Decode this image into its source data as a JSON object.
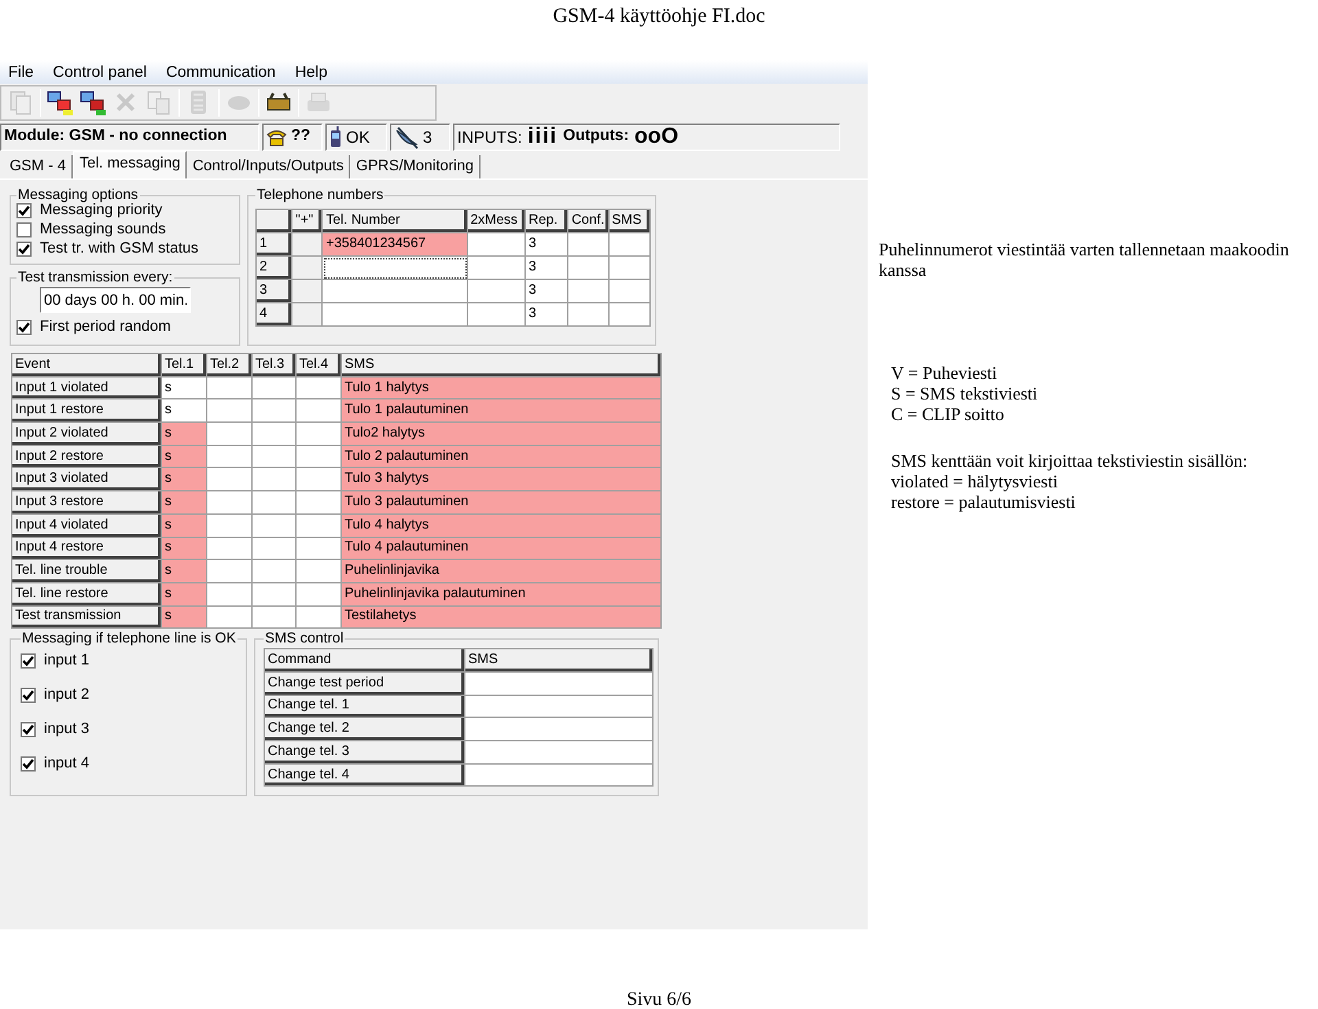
{
  "document": {
    "title": "GSM-4 käyttöohje FI.doc",
    "footer": "Sivu 6/6"
  },
  "app": {
    "menu": [
      "File",
      "Control panel",
      "Communication",
      "Help"
    ],
    "toolbar": [
      {
        "kind": "pages",
        "disabled": true
      },
      {
        "kind": "separator"
      },
      {
        "kind": "network",
        "disabled": false
      },
      {
        "kind": "network_alt",
        "disabled": false
      },
      {
        "kind": "delete",
        "disabled": true
      },
      {
        "kind": "copy",
        "disabled": true
      },
      {
        "kind": "separator"
      },
      {
        "kind": "keypad",
        "disabled": true
      },
      {
        "kind": "separator"
      },
      {
        "kind": "oval",
        "disabled": true
      },
      {
        "kind": "separator"
      },
      {
        "kind": "modem",
        "disabled": false
      },
      {
        "kind": "separator"
      },
      {
        "kind": "printer",
        "disabled": true
      }
    ],
    "status": {
      "module": "Module: GSM - no connection",
      "phone": "??",
      "gsm": "OK",
      "satellite": "3",
      "inputs_label": "INPUTS:",
      "inputs_value": "iiii",
      "outputs_label": "Outputs:",
      "outputs_value": "ooO"
    },
    "tabs": [
      {
        "label": "GSM - 4",
        "selected": false
      },
      {
        "label": "Tel. messaging",
        "selected": true
      },
      {
        "label": "Control/Inputs/Outputs",
        "selected": false
      },
      {
        "label": "GPRS/Monitoring",
        "selected": false
      }
    ],
    "messaging_options": {
      "title": "Messaging options",
      "items": [
        {
          "label": "Messaging priority",
          "checked": true
        },
        {
          "label": "Messaging sounds",
          "checked": false
        },
        {
          "label": "Test tr. with GSM status",
          "checked": true
        }
      ]
    },
    "test_transmission": {
      "title": "Test transmission every:",
      "value": "00 days 00 h. 00 min.",
      "first_period": {
        "label": "First period random",
        "checked": true
      }
    },
    "telephone_numbers": {
      "title": "Telephone numbers",
      "columns": [
        "\"+\"",
        "Tel. Number",
        "2xMess",
        "Rep.",
        "Conf.",
        "SMS"
      ],
      "rows": [
        {
          "index": "1",
          "number": "+358401234567",
          "highlighted": true,
          "focused": false,
          "rep": "3"
        },
        {
          "index": "2",
          "highlighted": false,
          "focused": true,
          "rep": "3"
        },
        {
          "index": "3",
          "highlighted": false,
          "focused": false,
          "rep": "3"
        },
        {
          "index": "4",
          "highlighted": false,
          "focused": false,
          "rep": "3"
        }
      ]
    },
    "events": {
      "columns": [
        "Event",
        "Tel.1",
        "Tel.2",
        "Tel.3",
        "Tel.4",
        "SMS"
      ],
      "rows": [
        {
          "event": "Input 1 violated",
          "tel_1": "s",
          "tel_1_highlighted": false,
          "sms": "Tulo 1 halytys",
          "sms_highlighted": true
        },
        {
          "event": "Input 1 restore",
          "tel_1": "s",
          "tel_1_highlighted": false,
          "sms": "Tulo 1 palautuminen",
          "sms_highlighted": true
        },
        {
          "event": "Input 2 violated",
          "tel_1": "s",
          "tel_1_highlighted": true,
          "sms": "Tulo2 halytys",
          "sms_highlighted": true
        },
        {
          "event": "Input 2 restore",
          "tel_1": "s",
          "tel_1_highlighted": true,
          "sms": "Tulo 2 palautuminen",
          "sms_highlighted": true
        },
        {
          "event": "Input 3 violated",
          "tel_1": "s",
          "tel_1_highlighted": true,
          "sms": "Tulo 3 halytys",
          "sms_highlighted": true
        },
        {
          "event": "Input 3 restore",
          "tel_1": "s",
          "tel_1_highlighted": true,
          "sms": "Tulo 3 palautuminen",
          "sms_highlighted": true
        },
        {
          "event": "Input 4 violated",
          "tel_1": "s",
          "tel_1_highlighted": true,
          "sms": "Tulo 4 halytys",
          "sms_highlighted": true
        },
        {
          "event": "Input 4 restore",
          "tel_1": "s",
          "tel_1_highlighted": true,
          "sms": "Tulo 4 palautuminen",
          "sms_highlighted": true
        },
        {
          "event": "Tel. line trouble",
          "tel_1": "s",
          "tel_1_highlighted": true,
          "sms": "Puhelinlinjavika",
          "sms_highlighted": true
        },
        {
          "event": "Tel. line restore",
          "tel_1": "s",
          "tel_1_highlighted": true,
          "sms": "Puhelinlinjavika palautuminen",
          "sms_highlighted": true
        },
        {
          "event": "Test transmission",
          "tel_1": "s",
          "tel_1_highlighted": true,
          "sms": "Testilahetys",
          "sms_highlighted": true
        }
      ]
    },
    "line_ok": {
      "title": "Messaging if telephone line is OK",
      "items": [
        {
          "label": "input 1",
          "checked": true
        },
        {
          "label": "input 2",
          "checked": true
        },
        {
          "label": "input 3",
          "checked": true
        },
        {
          "label": "input 4",
          "checked": true
        }
      ]
    },
    "sms_control": {
      "title": "SMS control",
      "columns": [
        "Command",
        "SMS"
      ],
      "rows": [
        "Change test period",
        "Change tel. 1",
        "Change tel. 2",
        "Change tel. 3",
        "Change tel. 4"
      ]
    }
  },
  "notes": {
    "intro": "Puhelinnumerot viestintää varten tallennetaan maakoodin kanssa",
    "legend": [
      "V = Puheviesti",
      "S = SMS tekstiviesti",
      "C = CLIP soitto"
    ],
    "sms_help": [
      "SMS kenttään voit kirjoittaa tekstiviestin sisällön:",
      "violated = hälytysviesti",
      "restore = palautumisviesti"
    ]
  }
}
